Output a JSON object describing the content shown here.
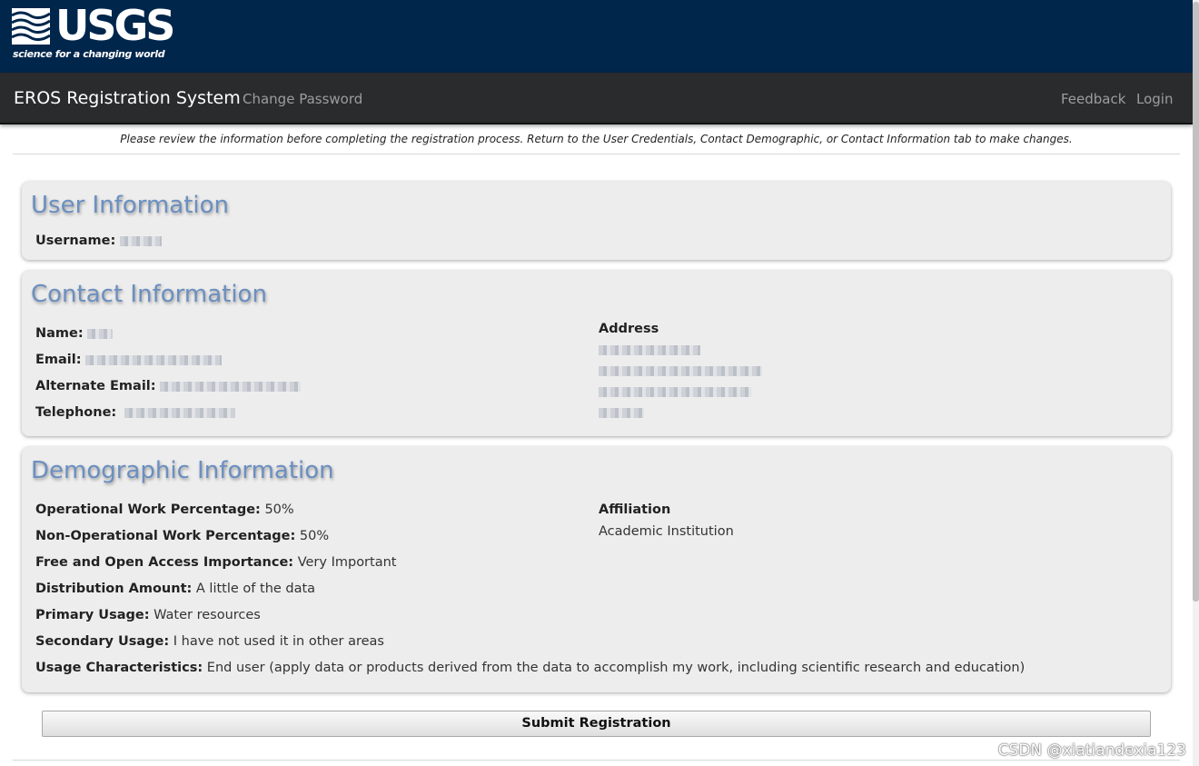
{
  "header": {
    "logo_text": "USGS",
    "tagline": "science for a changing world"
  },
  "nav": {
    "brand": "EROS Registration System",
    "change_password": "Change Password",
    "feedback": "Feedback",
    "login": "Login"
  },
  "notice": "Please review the information before completing the registration process. Return to the User Credentials, Contact Demographic, or Contact Information tab to make changes.",
  "user_info": {
    "title": "User Information",
    "username_label": "Username:"
  },
  "contact_info": {
    "title": "Contact Information",
    "name_label": "Name:",
    "email_label": "Email:",
    "alt_email_label": "Alternate Email:",
    "telephone_label": "Telephone:",
    "address_label": "Address"
  },
  "demographic": {
    "title": "Demographic Information",
    "fields": [
      {
        "label": "Operational Work Percentage:",
        "value": " 50%"
      },
      {
        "label": "Non-Operational Work Percentage:",
        "value": " 50%"
      },
      {
        "label": "Free and Open Access Importance:",
        "value": " Very Important"
      },
      {
        "label": "Distribution Amount:",
        "value": " A little of the data"
      },
      {
        "label": "Primary Usage:",
        "value": " Water resources"
      },
      {
        "label": "Secondary Usage:",
        "value": " I have not used it in other areas"
      },
      {
        "label": "Usage Characteristics:",
        "value": " End user (apply data or products derived from the data to accomplish my work, including scientific research and education)"
      }
    ],
    "affiliation_label": "Affiliation",
    "affiliation_value": "Academic Institution"
  },
  "submit_label": "Submit Registration",
  "watermark": "CSDN @xiatiandexia123"
}
